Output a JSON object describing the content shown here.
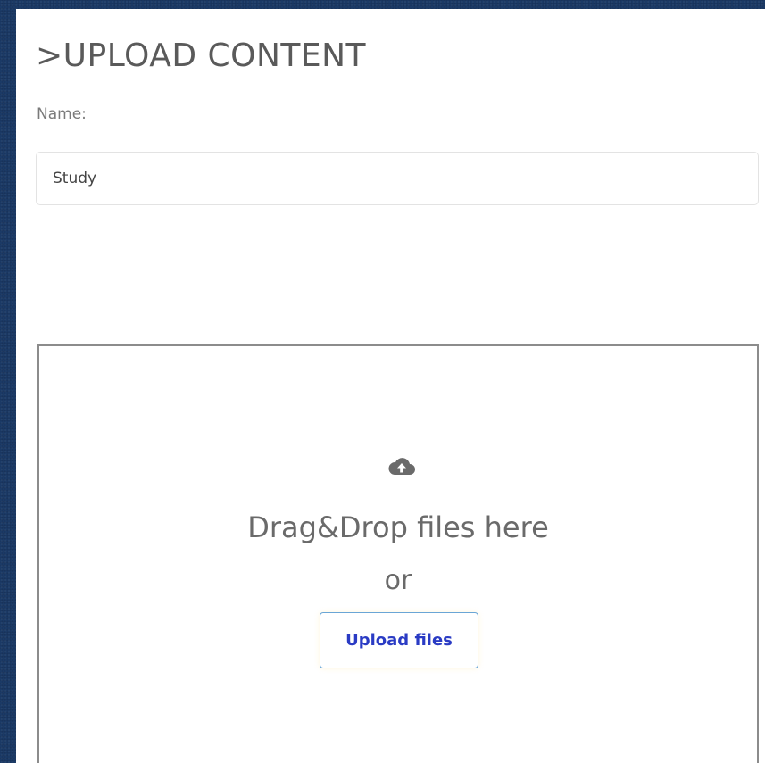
{
  "header": {
    "title": ">UPLOAD CONTENT"
  },
  "form": {
    "name_label": "Name:",
    "name_value": "Study"
  },
  "dropzone": {
    "icon": "cloud-upload-icon",
    "drop_text": "Drag&Drop files here",
    "or_text": "or",
    "upload_label": "Upload files"
  },
  "colors": {
    "background": "#1b3a66",
    "panel": "#ffffff",
    "button_text": "#2a3bc4",
    "button_border": "#6aa6d6",
    "text_gray": "#6a6a6a"
  }
}
